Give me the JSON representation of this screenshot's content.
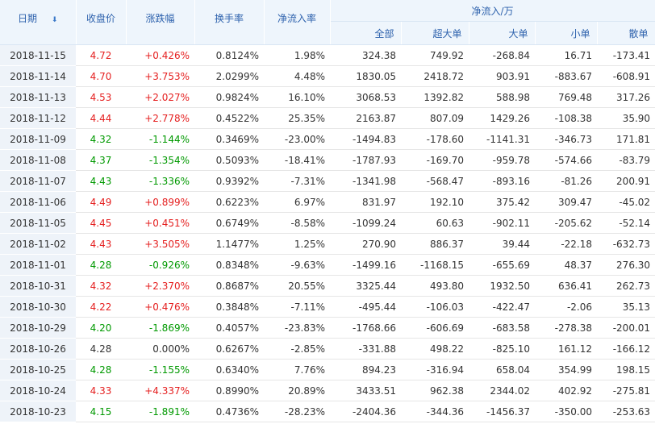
{
  "headers": {
    "date": "日期",
    "close": "收盘价",
    "change_pct": "涨跌幅",
    "turnover": "换手率",
    "net_inflow_rate": "净流入率",
    "net_inflow_group": "净流入/万",
    "all": "全部",
    "super_large": "超大单",
    "large": "大单",
    "small": "小单",
    "retail": "散单",
    "sort_icon": "arrow-down-icon"
  },
  "colors": {
    "up": "#e52020",
    "down": "#009900",
    "neutral": "#333333",
    "header_text": "#2e62ad",
    "header_bg": "#eef5fc",
    "date_bg": "#eef3f9"
  },
  "rows": [
    {
      "date": "2018-11-15",
      "close": "4.72",
      "change": "+0.426%",
      "turnover": "0.8124%",
      "rate": "1.98%",
      "all": "324.38",
      "super": "749.92",
      "large": "-268.84",
      "small": "16.71",
      "retail": "-173.41",
      "trend": "up"
    },
    {
      "date": "2018-11-14",
      "close": "4.70",
      "change": "+3.753%",
      "turnover": "2.0299%",
      "rate": "4.48%",
      "all": "1830.05",
      "super": "2418.72",
      "large": "903.91",
      "small": "-883.67",
      "retail": "-608.91",
      "trend": "up"
    },
    {
      "date": "2018-11-13",
      "close": "4.53",
      "change": "+2.027%",
      "turnover": "0.9824%",
      "rate": "16.10%",
      "all": "3068.53",
      "super": "1392.82",
      "large": "588.98",
      "small": "769.48",
      "retail": "317.26",
      "trend": "up"
    },
    {
      "date": "2018-11-12",
      "close": "4.44",
      "change": "+2.778%",
      "turnover": "0.4522%",
      "rate": "25.35%",
      "all": "2163.87",
      "super": "807.09",
      "large": "1429.26",
      "small": "-108.38",
      "retail": "35.90",
      "trend": "up"
    },
    {
      "date": "2018-11-09",
      "close": "4.32",
      "change": "-1.144%",
      "turnover": "0.3469%",
      "rate": "-23.00%",
      "all": "-1494.83",
      "super": "-178.60",
      "large": "-1141.31",
      "small": "-346.73",
      "retail": "171.81",
      "trend": "down"
    },
    {
      "date": "2018-11-08",
      "close": "4.37",
      "change": "-1.354%",
      "turnover": "0.5093%",
      "rate": "-18.41%",
      "all": "-1787.93",
      "super": "-169.70",
      "large": "-959.78",
      "small": "-574.66",
      "retail": "-83.79",
      "trend": "down"
    },
    {
      "date": "2018-11-07",
      "close": "4.43",
      "change": "-1.336%",
      "turnover": "0.9392%",
      "rate": "-7.31%",
      "all": "-1341.98",
      "super": "-568.47",
      "large": "-893.16",
      "small": "-81.26",
      "retail": "200.91",
      "trend": "down"
    },
    {
      "date": "2018-11-06",
      "close": "4.49",
      "change": "+0.899%",
      "turnover": "0.6223%",
      "rate": "6.97%",
      "all": "831.97",
      "super": "192.10",
      "large": "375.42",
      "small": "309.47",
      "retail": "-45.02",
      "trend": "up"
    },
    {
      "date": "2018-11-05",
      "close": "4.45",
      "change": "+0.451%",
      "turnover": "0.6749%",
      "rate": "-8.58%",
      "all": "-1099.24",
      "super": "60.63",
      "large": "-902.11",
      "small": "-205.62",
      "retail": "-52.14",
      "trend": "up"
    },
    {
      "date": "2018-11-02",
      "close": "4.43",
      "change": "+3.505%",
      "turnover": "1.1477%",
      "rate": "1.25%",
      "all": "270.90",
      "super": "886.37",
      "large": "39.44",
      "small": "-22.18",
      "retail": "-632.73",
      "trend": "up"
    },
    {
      "date": "2018-11-01",
      "close": "4.28",
      "change": "-0.926%",
      "turnover": "0.8348%",
      "rate": "-9.63%",
      "all": "-1499.16",
      "super": "-1168.15",
      "large": "-655.69",
      "small": "48.37",
      "retail": "276.30",
      "trend": "down"
    },
    {
      "date": "2018-10-31",
      "close": "4.32",
      "change": "+2.370%",
      "turnover": "0.8687%",
      "rate": "20.55%",
      "all": "3325.44",
      "super": "493.80",
      "large": "1932.50",
      "small": "636.41",
      "retail": "262.73",
      "trend": "up"
    },
    {
      "date": "2018-10-30",
      "close": "4.22",
      "change": "+0.476%",
      "turnover": "0.3848%",
      "rate": "-7.11%",
      "all": "-495.44",
      "super": "-106.03",
      "large": "-422.47",
      "small": "-2.06",
      "retail": "35.13",
      "trend": "up"
    },
    {
      "date": "2018-10-29",
      "close": "4.20",
      "change": "-1.869%",
      "turnover": "0.4057%",
      "rate": "-23.83%",
      "all": "-1768.66",
      "super": "-606.69",
      "large": "-683.58",
      "small": "-278.38",
      "retail": "-200.01",
      "trend": "down"
    },
    {
      "date": "2018-10-26",
      "close": "4.28",
      "change": "0.000%",
      "turnover": "0.6267%",
      "rate": "-2.85%",
      "all": "-331.88",
      "super": "498.22",
      "large": "-825.10",
      "small": "161.12",
      "retail": "-166.12",
      "trend": "neu"
    },
    {
      "date": "2018-10-25",
      "close": "4.28",
      "change": "-1.155%",
      "turnover": "0.6340%",
      "rate": "7.76%",
      "all": "894.23",
      "super": "-316.94",
      "large": "658.04",
      "small": "354.99",
      "retail": "198.15",
      "trend": "down"
    },
    {
      "date": "2018-10-24",
      "close": "4.33",
      "change": "+4.337%",
      "turnover": "0.8990%",
      "rate": "20.89%",
      "all": "3433.51",
      "super": "962.38",
      "large": "2344.02",
      "small": "402.92",
      "retail": "-275.81",
      "trend": "up"
    },
    {
      "date": "2018-10-23",
      "close": "4.15",
      "change": "-1.891%",
      "turnover": "0.4736%",
      "rate": "-28.23%",
      "all": "-2404.36",
      "super": "-344.36",
      "large": "-1456.37",
      "small": "-350.00",
      "retail": "-253.63",
      "trend": "down"
    }
  ]
}
